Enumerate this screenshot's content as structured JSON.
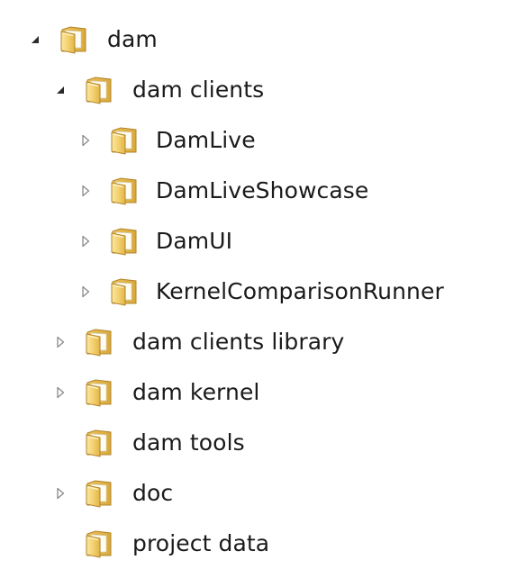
{
  "tree": {
    "items": [
      {
        "label": "dam",
        "level": 0,
        "toggle": "expanded"
      },
      {
        "label": "dam clients",
        "level": 1,
        "toggle": "expanded"
      },
      {
        "label": "DamLive",
        "level": 2,
        "toggle": "collapsed"
      },
      {
        "label": "DamLiveShowcase",
        "level": 2,
        "toggle": "collapsed"
      },
      {
        "label": "DamUI",
        "level": 2,
        "toggle": "collapsed"
      },
      {
        "label": "KernelComparisonRunner",
        "level": 2,
        "toggle": "collapsed"
      },
      {
        "label": "dam clients library",
        "level": 1,
        "toggle": "collapsed"
      },
      {
        "label": "dam kernel",
        "level": 1,
        "toggle": "collapsed"
      },
      {
        "label": "dam tools",
        "level": 1,
        "toggle": "none"
      },
      {
        "label": "doc",
        "level": 1,
        "toggle": "collapsed"
      },
      {
        "label": "project data",
        "level": 1,
        "toggle": "none"
      }
    ]
  },
  "icons": {
    "folder": "folder-icon",
    "expanded": "expanded-triangle-icon",
    "collapsed": "collapsed-triangle-icon"
  },
  "colors": {
    "folder_front": "#f2cf6b",
    "folder_back": "#d9a93a",
    "folder_edge": "#b3842a",
    "expanded_arrow": "#2b2b2b",
    "collapsed_arrow": "#8a8a8a",
    "text": "#1a1a1a"
  }
}
